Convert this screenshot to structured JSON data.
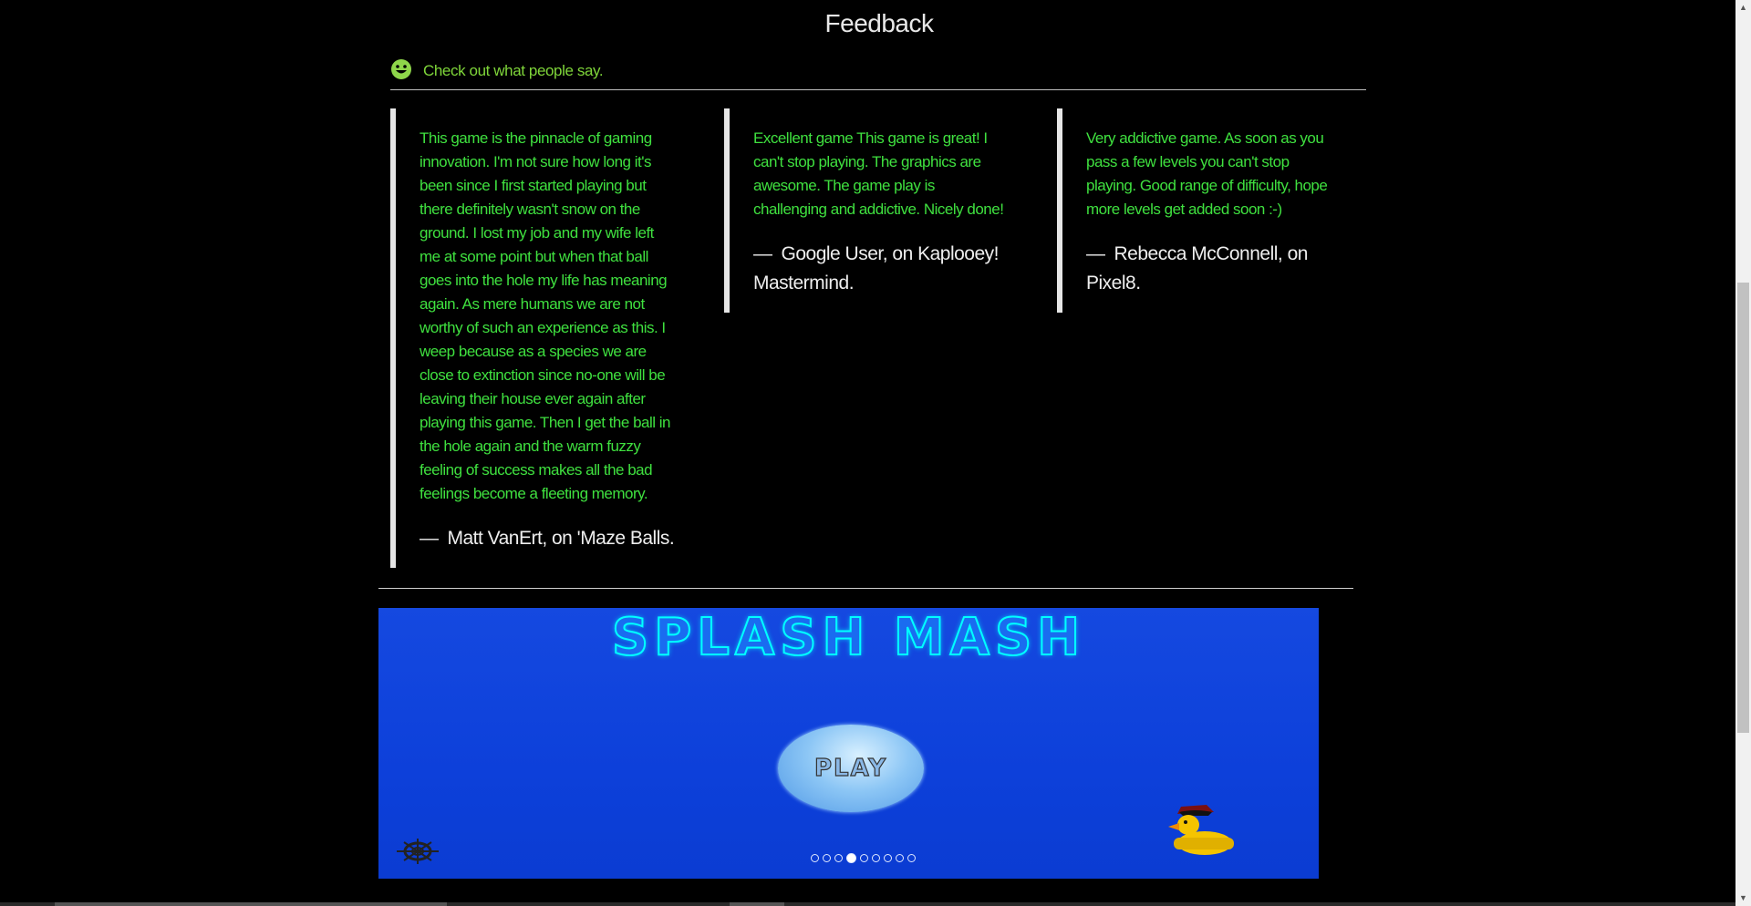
{
  "feedback": {
    "title": "Feedback",
    "subheading": "Check out what people say.",
    "quotes": [
      {
        "text": "This game is the pinnacle of gaming innovation. I'm not sure how long it's been since I first started playing but there definitely wasn't snow on the ground. I lost my job and my wife left me at some point but when that ball goes into the hole my life has meaning again. As mere humans we are not worthy of such an experience as this. I weep because as a species we are close to extinction since no-one will be leaving their house ever again after playing this game. Then I get the ball in the hole again and the warm fuzzy feeling of success makes all the bad feelings become a fleeting memory.",
        "dash": "—",
        "cite": "Matt VanErt, on 'Maze Balls."
      },
      {
        "text": "Excellent game This game is great! I can't stop playing. The graphics are awesome. The game play is challenging and addictive. Nicely done!",
        "dash": "—",
        "cite": "Google User, on Kaplooey! Mastermind."
      },
      {
        "text": "Very addictive game. As soon as you pass a few levels you can't stop playing. Good range of difficulty, hope more levels get added soon :-)",
        "dash": "—",
        "cite": "Rebecca McConnell, on Pixel8."
      }
    ]
  },
  "game_banner": {
    "logo": "SPLASH MASH",
    "play_label": "PLAY",
    "slider": {
      "total": 9,
      "active_index": 3
    },
    "icons": {
      "settings": "ship-wheel-icon",
      "duck": "rubber-duck-icon",
      "smile": "smile-icon"
    }
  },
  "colors": {
    "accent_green": "#3fe03f",
    "subhead_green": "#7fd63a",
    "banner_blue": "#0d40da"
  }
}
